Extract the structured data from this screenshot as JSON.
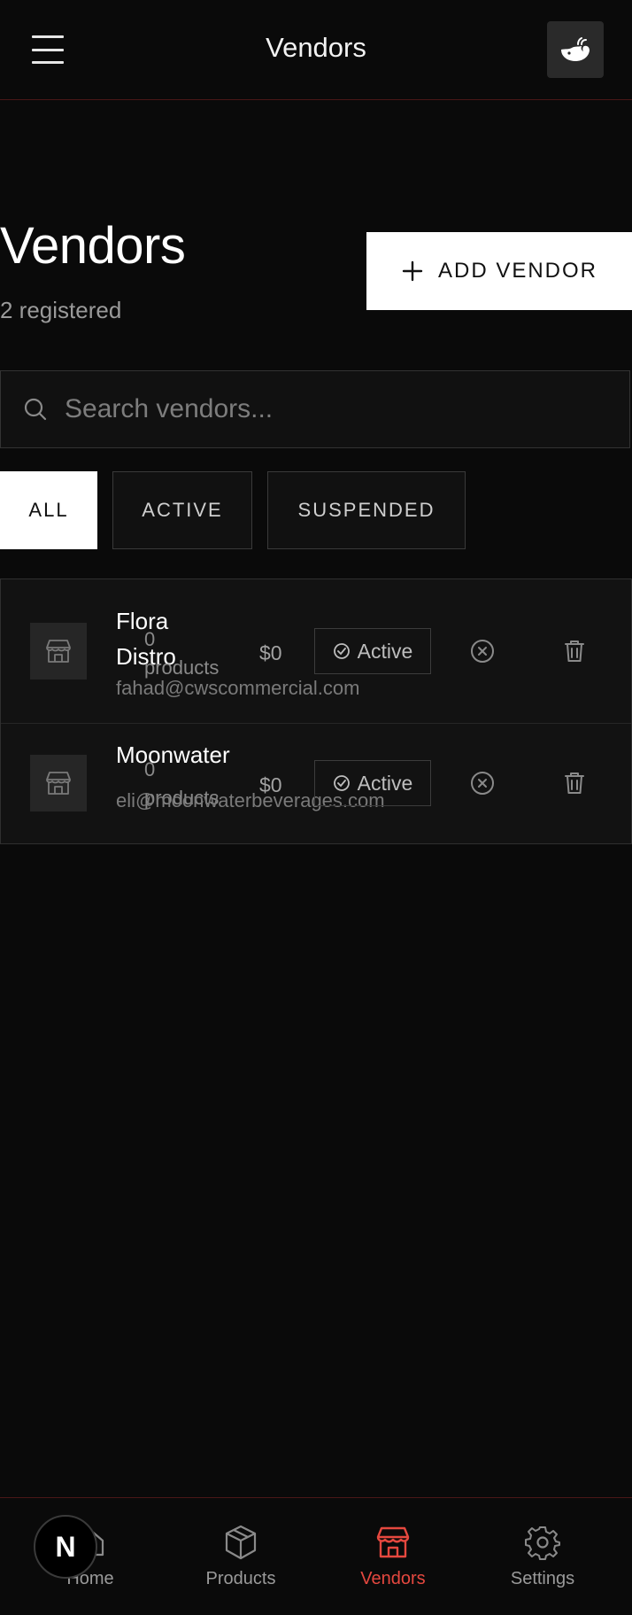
{
  "header": {
    "title": "Vendors"
  },
  "page": {
    "title": "Vendors",
    "subtitle": "2 registered",
    "add_label": "ADD VENDOR"
  },
  "search": {
    "placeholder": "Search vendors..."
  },
  "filters": [
    {
      "label": "ALL",
      "active": true
    },
    {
      "label": "ACTIVE",
      "active": false
    },
    {
      "label": "SUSPENDED",
      "active": false
    }
  ],
  "vendors": [
    {
      "name_line1": "Flora",
      "name_line2": "Distro",
      "email": "fahad@cwscommercial.com",
      "count": "0",
      "count_unit": "products",
      "revenue": "$0",
      "status": "Active"
    },
    {
      "name_line1": "Moonwater",
      "email": "eli@moonwaterbeverages.com",
      "count": "0",
      "count_unit": "products",
      "revenue": "$0",
      "status": "Active"
    }
  ],
  "nav": [
    {
      "label": "Home",
      "icon": "home-icon"
    },
    {
      "label": "Products",
      "icon": "package-icon"
    },
    {
      "label": "Vendors",
      "icon": "store-icon",
      "selected": true
    },
    {
      "label": "Settings",
      "icon": "gear-icon"
    }
  ],
  "fab": {
    "letter": "N"
  },
  "colors": {
    "accent": "#e5483f",
    "background": "#0a0a0a"
  }
}
